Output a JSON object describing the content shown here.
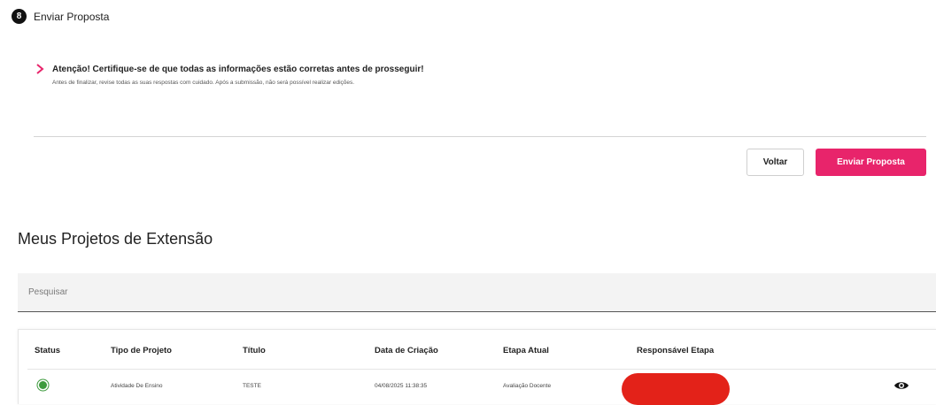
{
  "step": {
    "number": "8",
    "title": "Enviar Proposta"
  },
  "alert": {
    "icon": "chevron-right-icon",
    "title": "Atenção! Certifique-se de que todas as informações estão corretas antes de prosseguir!",
    "description": "Antes de finalizar, revise todas as suas respostas com cuidado. Após a submissão, não será possível realizar edições."
  },
  "actions": {
    "back_label": "Voltar",
    "submit_label": "Enviar Proposta"
  },
  "projects": {
    "title": "Meus Projetos de Extensão",
    "search_placeholder": "Pesquisar",
    "columns": [
      "Status",
      "Tipo de Projeto",
      "Título",
      "Data de Criação",
      "Etapa Atual",
      "Responsável Etapa"
    ],
    "rows": [
      {
        "status": "active",
        "type": "Atividade De Ensino",
        "title": "TESTE",
        "created": "04/08/2025 11:38:35",
        "stage": "Avaliação Docente",
        "responsible": "",
        "action_icon": "eye-icon"
      }
    ]
  },
  "colors": {
    "accent": "#e8246b",
    "status_active": "#3e9b3e",
    "redaction": "#e32219"
  }
}
